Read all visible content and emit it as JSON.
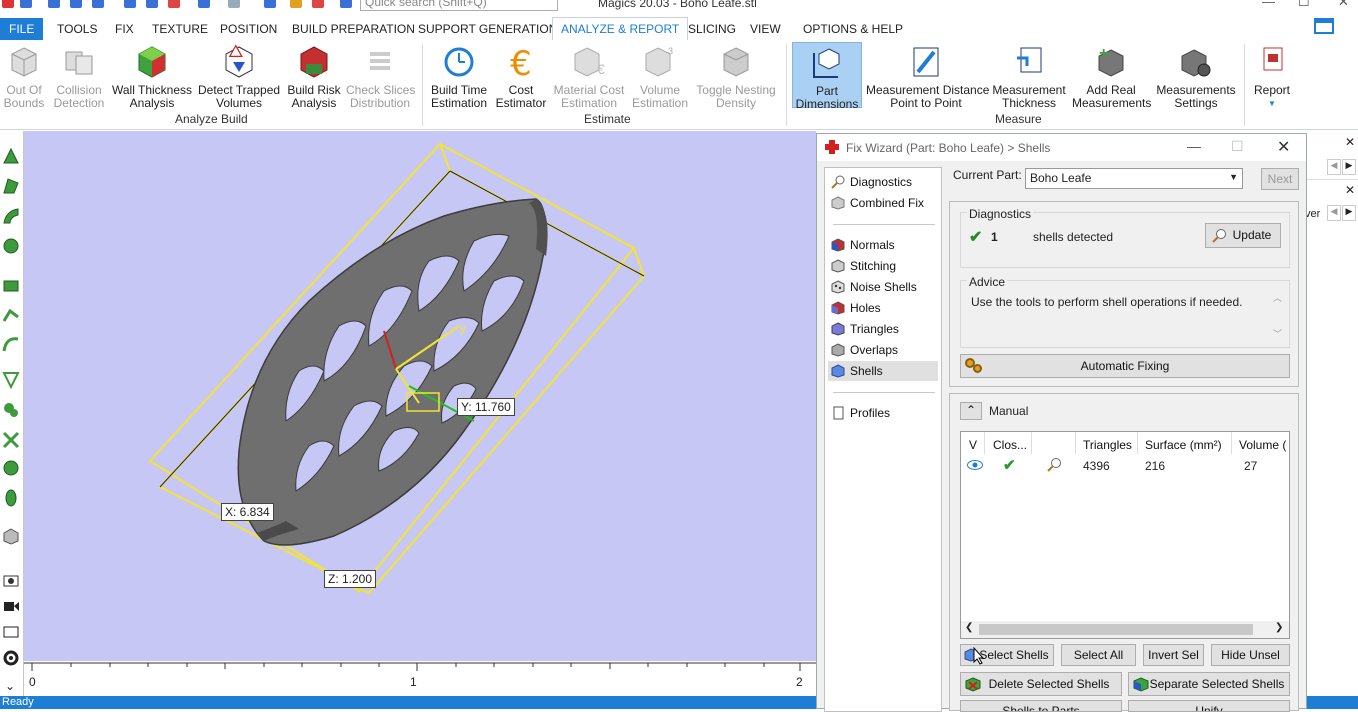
{
  "window": {
    "title": "Magics 20.03 - Boho Leafe.stl",
    "search_placeholder": "Quick search (Shift+Q)"
  },
  "menu": {
    "tabs": [
      "FILE",
      "TOOLS",
      "FIX",
      "TEXTURE",
      "POSITION",
      "BUILD PREPARATION",
      "SUPPORT GENERATION",
      "ANALYZE & REPORT",
      "SLICING",
      "VIEW",
      "OPTIONS & HELP"
    ],
    "active": "ANALYZE & REPORT"
  },
  "ribbon": {
    "analyze_build": {
      "label": "Analyze Build",
      "out_of_bounds": "Out Of\nBounds",
      "collision_detection": "Collision\nDetection",
      "wall_thickness": "Wall Thickness\nAnalysis",
      "detect_trapped": "Detect Trapped\nVolumes",
      "build_risk": "Build Risk\nAnalysis",
      "check_slices": "Check Slices\nDistribution"
    },
    "estimate": {
      "label": "Estimate",
      "build_time": "Build Time\nEstimation",
      "cost_estimator": "Cost\nEstimator",
      "material_cost": "Material Cost\nEstimation",
      "volume_estimation": "Volume\nEstimation",
      "toggle_nesting": "Toggle Nesting\nDensity"
    },
    "measure": {
      "label": "Measure",
      "part_dimensions": "Part\nDimensions",
      "distance_p2p": "Measurement Distance\nPoint to Point",
      "thickness": "Measurement\nThickness",
      "add_real": "Add Real\nMeasurements",
      "settings": "Measurements\nSettings"
    },
    "report": "Report"
  },
  "viewport": {
    "label_x": "X: 6.834",
    "label_y": "Y: 11.760",
    "label_z": "Z: 1.200",
    "axis_y": "y",
    "ruler": [
      "0",
      "1",
      "2"
    ]
  },
  "status": "Ready",
  "right_panel": {
    "text": "ver"
  },
  "fix_wizard": {
    "title": "Fix Wizard (Part: Boho Leafe) > Shells",
    "nav": {
      "diagnostics": "Diagnostics",
      "combined_fix": "Combined Fix",
      "normals": "Normals",
      "stitching": "Stitching",
      "noise_shells": "Noise Shells",
      "holes": "Holes",
      "triangles": "Triangles",
      "overlaps": "Overlaps",
      "shells": "Shells",
      "profiles": "Profiles"
    },
    "current_part_label": "Current Part:",
    "current_part": "Boho Leafe",
    "next": "Next",
    "diagnostics": {
      "label": "Diagnostics",
      "count": "1",
      "text": "shells detected",
      "update": "Update"
    },
    "advice": {
      "label": "Advice",
      "text": "Use the tools to perform shell operations if needed."
    },
    "automatic_fixing": "Automatic Fixing",
    "manual": "Manual",
    "table": {
      "headers": [
        "V",
        "Clos...",
        "",
        "Triangles",
        "Surface (mm²)",
        "Volume ("
      ],
      "row": {
        "triangles": "4396",
        "surface": "216",
        "volume": "27"
      }
    },
    "buttons": {
      "select_shells": "Select Shells",
      "select_all": "Select All",
      "invert_sel": "Invert Sel",
      "hide_unsel": "Hide Unsel",
      "delete_selected": "Delete Selected Shells",
      "separate_selected": "Separate Selected Shells",
      "shells_to_parts": "Shells to Parts",
      "unify": "Unify"
    }
  },
  "colors": {
    "accent": "#1e7ed6",
    "viewport_bg": "#c7c7f5",
    "bbox": "#f2e531",
    "part": "#6f6f6f"
  }
}
